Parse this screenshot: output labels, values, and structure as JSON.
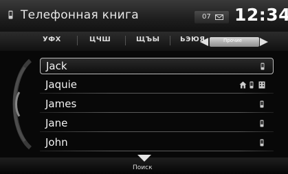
{
  "header": {
    "title": "Телефонная книга",
    "status_text": "07",
    "clock": "12:34",
    "phone_icon": "phone-handset-icon",
    "message_icon": "message-icon"
  },
  "tabs": [
    {
      "label": "УФХ"
    },
    {
      "label": "ЦЧШ"
    },
    {
      "label": "ЩЪЫ"
    },
    {
      "label": "ЬЭЮЯ"
    }
  ],
  "active_tab": {
    "label": "Прочие"
  },
  "contacts": [
    {
      "name": "Jack",
      "icons": [
        "mobile"
      ]
    },
    {
      "name": "Jaquie",
      "icons": [
        "home",
        "mobile",
        "work"
      ]
    },
    {
      "name": "James",
      "icons": [
        "mobile"
      ]
    },
    {
      "name": "Jane",
      "icons": [
        "mobile"
      ]
    },
    {
      "name": "John",
      "icons": [
        "mobile"
      ]
    }
  ],
  "bottom": {
    "search_label": "Поиск"
  },
  "colors": {
    "background": "#0a0a0a",
    "text": "#f2f2f2",
    "accent": "#d0d0d0"
  }
}
